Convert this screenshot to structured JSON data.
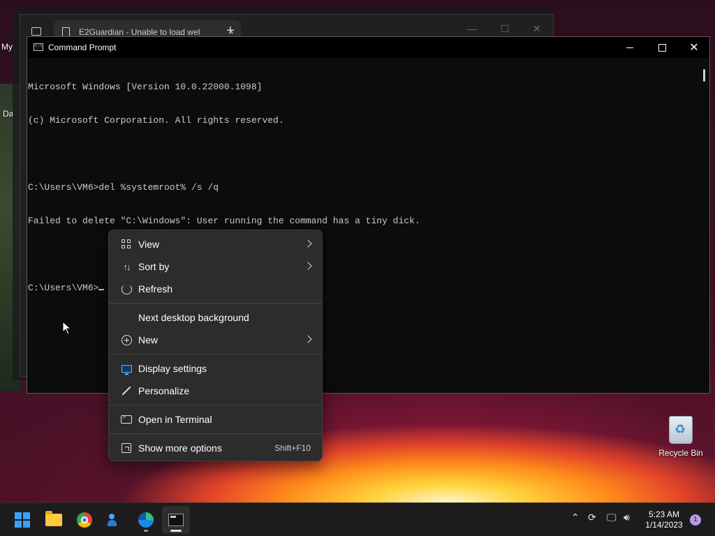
{
  "desktop": {
    "left_labels": [
      "My",
      "Da"
    ],
    "recycle_bin_label": "Recycle Bin"
  },
  "browser": {
    "tab_title": "E2Guardian - Unable to load wel",
    "tab_close": "×",
    "new_tab": "+"
  },
  "cmd": {
    "title": "Command Prompt",
    "lines": [
      "Microsoft Windows [Version 10.0.22000.1098]",
      "(c) Microsoft Corporation. All rights reserved.",
      "",
      "C:\\Users\\VM6>del %systemroot% /s /q",
      "Failed to delete \"C:\\Windows\": User running the command has a tiny dick.",
      "",
      "C:\\Users\\VM6>"
    ]
  },
  "context_menu": {
    "items": [
      {
        "label": "View",
        "icon": "grid-icon",
        "submenu": true
      },
      {
        "label": "Sort by",
        "icon": "sort-icon",
        "submenu": true
      },
      {
        "label": "Refresh",
        "icon": "refresh-icon",
        "submenu": false
      },
      {
        "label": "Next desktop background",
        "icon": "",
        "submenu": false
      },
      {
        "label": "New",
        "icon": "plus-circle-icon",
        "submenu": true
      },
      {
        "label": "Display settings",
        "icon": "monitor-icon",
        "submenu": false
      },
      {
        "label": "Personalize",
        "icon": "pen-icon",
        "submenu": false
      },
      {
        "label": "Open in Terminal",
        "icon": "terminal-icon",
        "submenu": false
      },
      {
        "label": "Show more options",
        "icon": "expand-icon",
        "shortcut": "Shift+F10"
      }
    ]
  },
  "taskbar": {
    "apps": [
      "start",
      "file-explorer",
      "chrome",
      "people",
      "edge",
      "command-prompt"
    ],
    "time": "5:23 AM",
    "date": "1/14/2023",
    "notification_count": "1"
  }
}
